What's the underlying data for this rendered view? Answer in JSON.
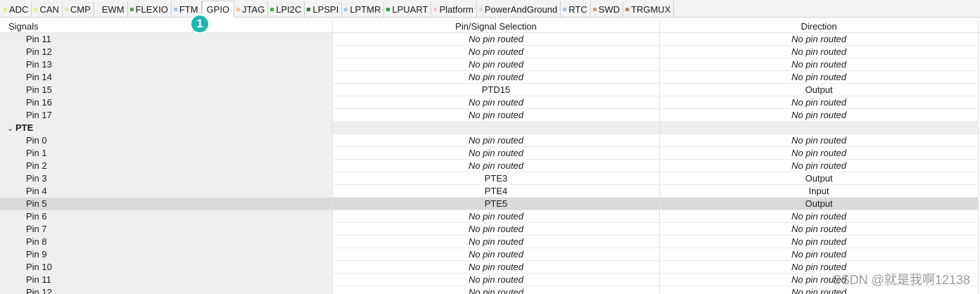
{
  "tabs": [
    {
      "label": "ADC",
      "color": "#f0e6a0",
      "active": false
    },
    {
      "label": "CAN",
      "color": "#f0e6a0",
      "active": false
    },
    {
      "label": "CMP",
      "color": "#f0e6a0",
      "active": false
    },
    {
      "label": "EWM",
      "color": "#f3f3f3",
      "active": false
    },
    {
      "label": "FLEXIO",
      "color": "#4caf50",
      "active": false
    },
    {
      "label": "FTM",
      "color": "#9ec9f0",
      "active": false
    },
    {
      "label": "GPIO",
      "color": "#f3f3f3",
      "active": true
    },
    {
      "label": "JTAG",
      "color": "#f0c9a0",
      "active": false
    },
    {
      "label": "LPI2C",
      "color": "#4caf50",
      "active": false
    },
    {
      "label": "LPSPI",
      "color": "#2e7d32",
      "active": false
    },
    {
      "label": "LPTMR",
      "color": "#9ec9f0",
      "active": false
    },
    {
      "label": "LPUART",
      "color": "#2e9d4f",
      "active": false
    },
    {
      "label": "Platform",
      "color": "#f0d0c0",
      "active": false
    },
    {
      "label": "PowerAndGround",
      "color": "#e8d8c8",
      "active": false
    },
    {
      "label": "RTC",
      "color": "#9ec9f0",
      "active": false
    },
    {
      "label": "SWD",
      "color": "#c8a888",
      "active": false
    },
    {
      "label": "TRGMUX",
      "color": "#b08860",
      "active": false
    }
  ],
  "badge": "1",
  "table": {
    "headers": {
      "signals": "Signals",
      "pin": "Pin/Signal Selection",
      "direction": "Direction"
    },
    "rows": [
      {
        "signal": "Pin 11",
        "pin": "No pin routed",
        "direction": "No pin routed"
      },
      {
        "signal": "Pin 12",
        "pin": "No pin routed",
        "direction": "No pin routed"
      },
      {
        "signal": "Pin 13",
        "pin": "No pin routed",
        "direction": "No pin routed"
      },
      {
        "signal": "Pin 14",
        "pin": "No pin routed",
        "direction": "No pin routed"
      },
      {
        "signal": "Pin 15",
        "pin": "PTD15",
        "direction": "Output"
      },
      {
        "signal": "Pin 16",
        "pin": "No pin routed",
        "direction": "No pin routed"
      },
      {
        "signal": "Pin 17",
        "pin": "No pin routed",
        "direction": "No pin routed"
      },
      {
        "signal": "PTE",
        "pin": "",
        "direction": "",
        "group": true,
        "chevron": "⌄"
      },
      {
        "signal": "Pin 0",
        "pin": "No pin routed",
        "direction": "No pin routed"
      },
      {
        "signal": "Pin 1",
        "pin": "No pin routed",
        "direction": "No pin routed"
      },
      {
        "signal": "Pin 2",
        "pin": "No pin routed",
        "direction": "No pin routed"
      },
      {
        "signal": "Pin 3",
        "pin": "PTE3",
        "direction": "Output"
      },
      {
        "signal": "Pin 4",
        "pin": "PTE4",
        "direction": "Input"
      },
      {
        "signal": "Pin 5",
        "pin": "PTE5",
        "direction": "Output",
        "selected": true
      },
      {
        "signal": "Pin 6",
        "pin": "No pin routed",
        "direction": "No pin routed"
      },
      {
        "signal": "Pin 7",
        "pin": "No pin routed",
        "direction": "No pin routed"
      },
      {
        "signal": "Pin 8",
        "pin": "No pin routed",
        "direction": "No pin routed"
      },
      {
        "signal": "Pin 9",
        "pin": "No pin routed",
        "direction": "No pin routed"
      },
      {
        "signal": "Pin 10",
        "pin": "No pin routed",
        "direction": "No pin routed"
      },
      {
        "signal": "Pin 11",
        "pin": "No pin routed",
        "direction": "No pin routed"
      },
      {
        "signal": "Pin 12",
        "pin": "No pin routed",
        "direction": "No pin routed"
      }
    ]
  },
  "watermark": "CSDN @就是我啊12138"
}
